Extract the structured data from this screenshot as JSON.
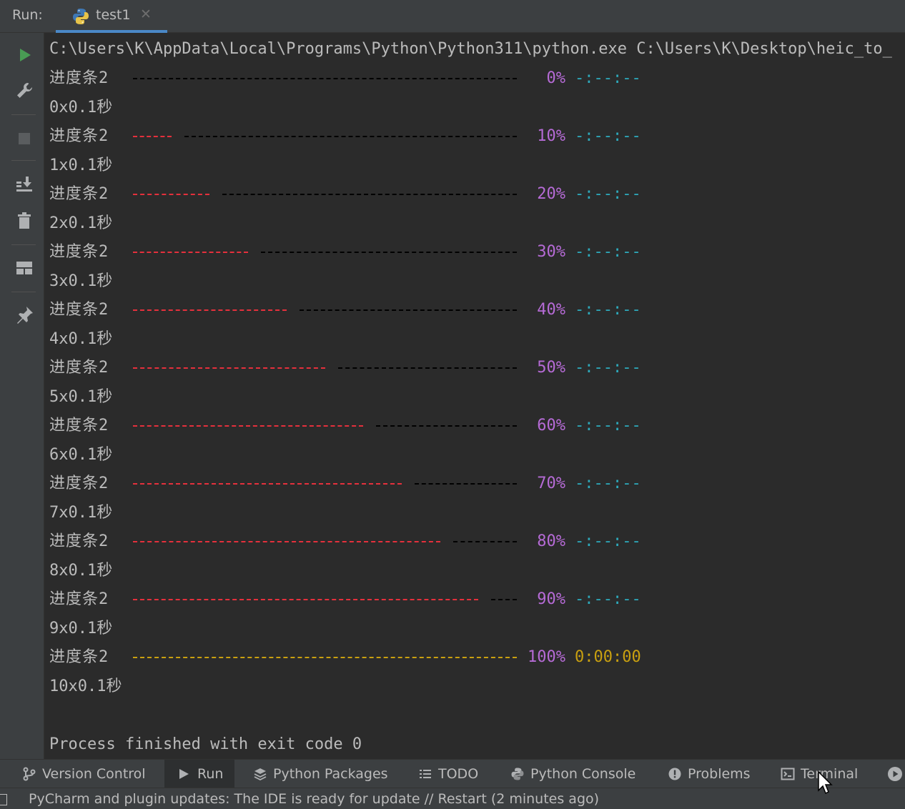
{
  "run_header": {
    "label": "Run:",
    "tab_label": "test1",
    "tab_close": "✕"
  },
  "sidebar": {
    "icons": [
      "run-icon",
      "wrench-icon",
      "stop-icon",
      "scroll-to-end-icon",
      "trash-icon",
      "layout-icon",
      "pin-icon"
    ]
  },
  "console": {
    "command": "C:\\Users\\K\\AppData\\Local\\Programs\\Python\\Python311\\python.exe C:\\Users\\K\\Desktop\\heic_to_",
    "progress": [
      {
        "label": "进度条2",
        "percent": "0%",
        "eta": "-:--:--",
        "fraction": 0.0,
        "step": "0x0.1秒"
      },
      {
        "label": "进度条2",
        "percent": "10%",
        "eta": "-:--:--",
        "fraction": 0.1,
        "step": "1x0.1秒"
      },
      {
        "label": "进度条2",
        "percent": "20%",
        "eta": "-:--:--",
        "fraction": 0.2,
        "step": "2x0.1秒"
      },
      {
        "label": "进度条2",
        "percent": "30%",
        "eta": "-:--:--",
        "fraction": 0.3,
        "step": "3x0.1秒"
      },
      {
        "label": "进度条2",
        "percent": "40%",
        "eta": "-:--:--",
        "fraction": 0.4,
        "step": "4x0.1秒"
      },
      {
        "label": "进度条2",
        "percent": "50%",
        "eta": "-:--:--",
        "fraction": 0.5,
        "step": "5x0.1秒"
      },
      {
        "label": "进度条2",
        "percent": "60%",
        "eta": "-:--:--",
        "fraction": 0.6,
        "step": "6x0.1秒"
      },
      {
        "label": "进度条2",
        "percent": "70%",
        "eta": "-:--:--",
        "fraction": 0.7,
        "step": "7x0.1秒"
      },
      {
        "label": "进度条2",
        "percent": "80%",
        "eta": "-:--:--",
        "fraction": 0.8,
        "step": "8x0.1秒"
      },
      {
        "label": "进度条2",
        "percent": "90%",
        "eta": "-:--:--",
        "fraction": 0.9,
        "step": "9x0.1秒"
      },
      {
        "label": "进度条2",
        "percent": "100%",
        "eta": "0:00:00",
        "fraction": 1.0,
        "step": "10x0.1秒"
      }
    ],
    "exit_message": "Process finished with exit code 0"
  },
  "colors": {
    "bar_done": "#e5303c",
    "bar_todo": "#000000",
    "bar_complete": "#c9a010",
    "percent": "#b66bd6",
    "eta": "#2da9bb"
  },
  "toolwindows": [
    {
      "label": "Version Control",
      "icon": "branch-icon",
      "active": false
    },
    {
      "label": "Run",
      "icon": "run-icon",
      "active": true
    },
    {
      "label": "Python Packages",
      "icon": "layers-icon",
      "active": false
    },
    {
      "label": "TODO",
      "icon": "list-icon",
      "active": false
    },
    {
      "label": "Python Console",
      "icon": "python-icon",
      "active": false
    },
    {
      "label": "Problems",
      "icon": "warning-icon",
      "active": false
    },
    {
      "label": "Terminal",
      "icon": "terminal-icon",
      "active": false
    }
  ],
  "status_bar": {
    "message": "PyCharm and plugin updates: The IDE is ready for update // Restart (2 minutes ago)"
  }
}
